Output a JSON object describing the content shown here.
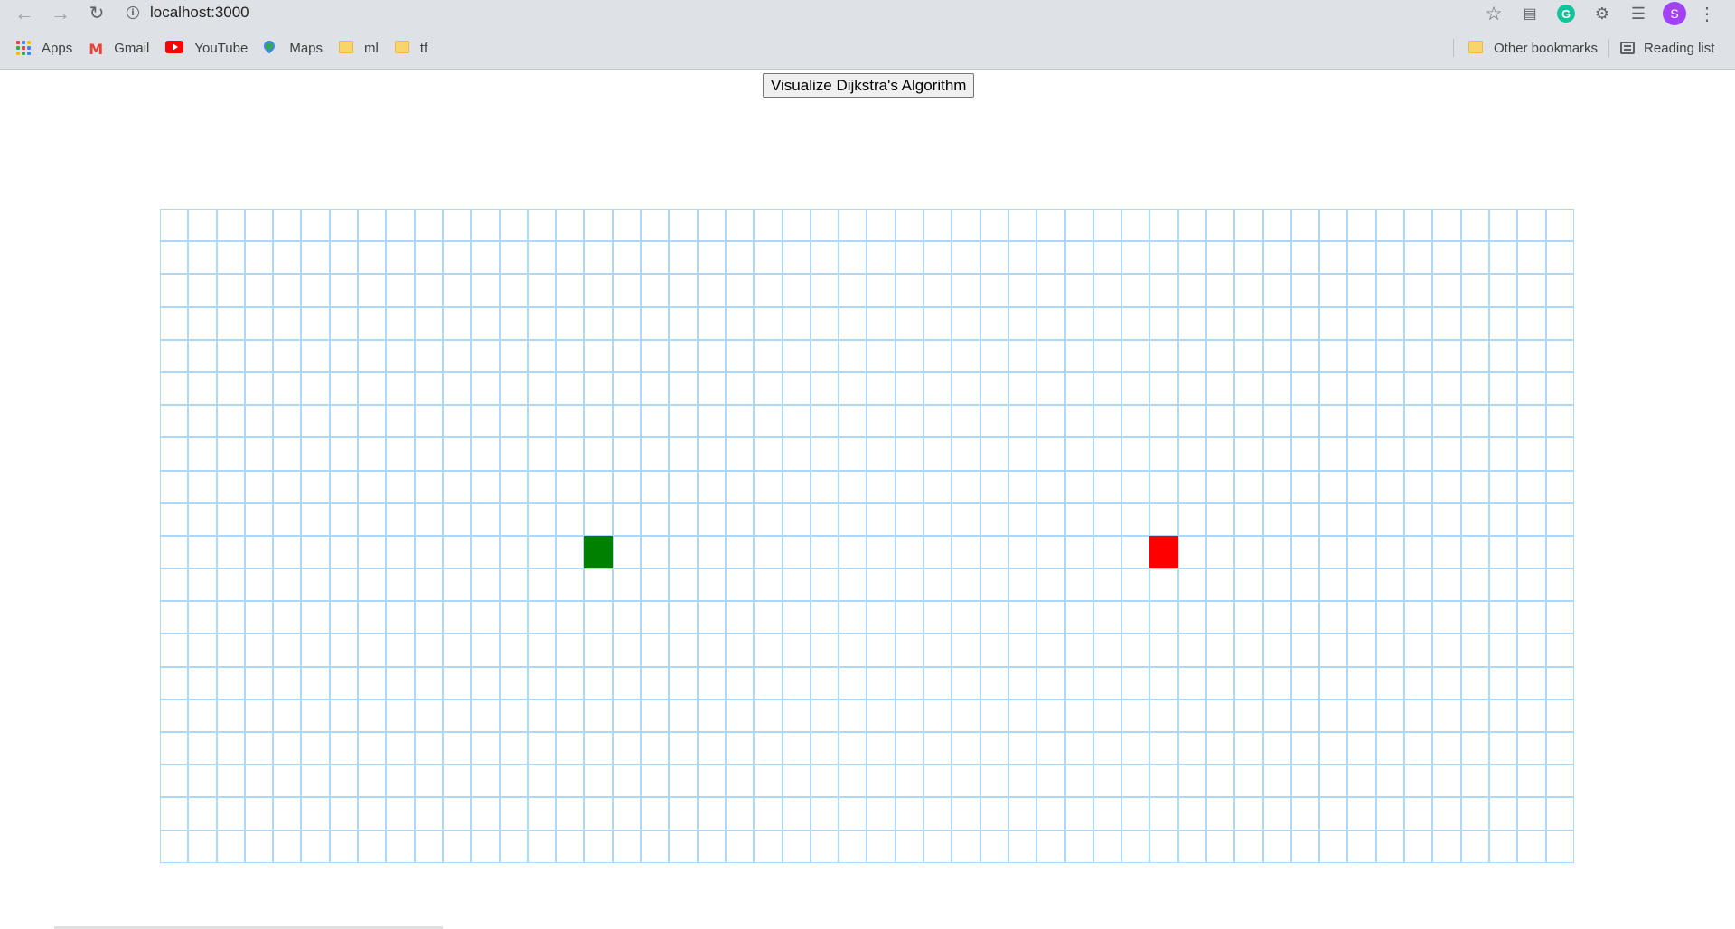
{
  "browser": {
    "url": "localhost:3000",
    "nav": {
      "back_icon": "arrow-left-icon",
      "forward_icon": "arrow-right-icon",
      "reload_icon": "reload-icon"
    },
    "avatar_letter": "S",
    "bookmarks": [
      {
        "label": "Apps",
        "icon": "apps-grid-icon"
      },
      {
        "label": "Gmail",
        "icon": "gmail-icon"
      },
      {
        "label": "YouTube",
        "icon": "youtube-icon"
      },
      {
        "label": "Maps",
        "icon": "maps-icon"
      },
      {
        "label": "ml",
        "icon": "folder-icon"
      },
      {
        "label": "tf",
        "icon": "folder-icon"
      }
    ],
    "other_bookmarks": "Other bookmarks",
    "reading_list": "Reading list"
  },
  "app": {
    "visualize_button": "Visualize Dijkstra's Algorithm",
    "grid": {
      "rows": 20,
      "cols": 50,
      "start": {
        "row": 10,
        "col": 15
      },
      "finish": {
        "row": 10,
        "col": 35
      }
    },
    "colors": {
      "start": "#008000",
      "finish": "#ff0000",
      "node_border": "#afd8f8"
    }
  }
}
